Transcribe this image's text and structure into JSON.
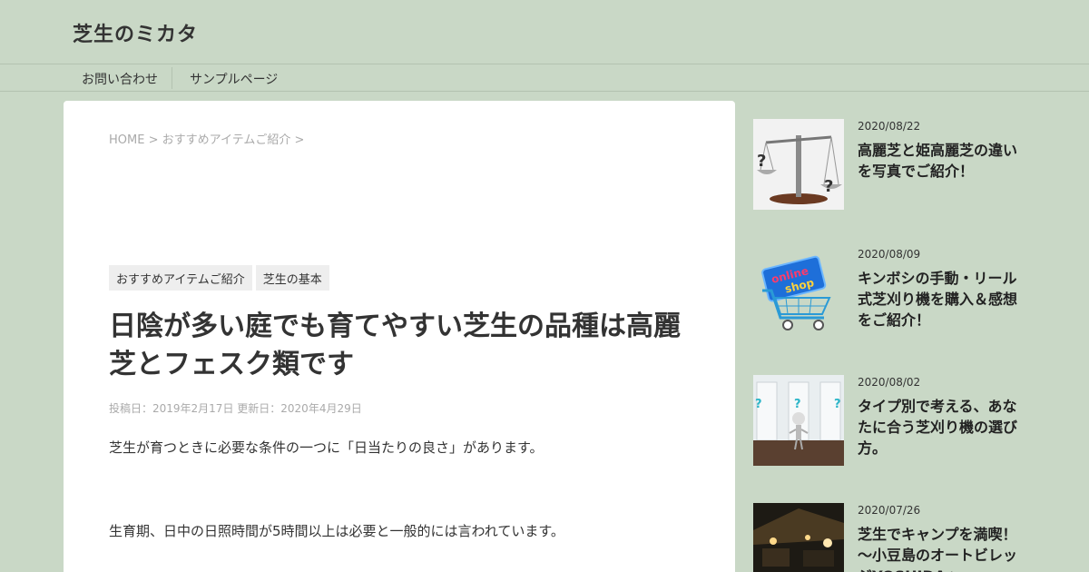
{
  "header": {
    "site_title": "芝生のミカタ"
  },
  "nav": {
    "items": [
      {
        "label": "お問い合わせ"
      },
      {
        "label": "サンプルページ"
      }
    ]
  },
  "article": {
    "breadcrumb": {
      "home": "HOME",
      "sep1": " > ",
      "category": "おすすめアイテムご紹介",
      "sep2": " >"
    },
    "categories": [
      {
        "label": "おすすめアイテムご紹介"
      },
      {
        "label": "芝生の基本"
      }
    ],
    "title": "日陰が多い庭でも育てやすい芝生の品種は高麗芝とフェスク類です",
    "posted": "投稿日：2019年2月17日",
    "updated": "更新日：2020年4月29日",
    "paragraphs": [
      "芝生が育つときに必要な条件の一つに「日当たりの良さ」があります。",
      "生育期、日中の日照時間が5時間以上は必要と一般的には言われています。"
    ]
  },
  "sidebar": {
    "posts": [
      {
        "date": "2020/08/22",
        "title": "高麗芝と姫高麗芝の違いを写真でご紹介！"
      },
      {
        "date": "2020/08/09",
        "title": "キンボシの手動・リール式芝刈り機を購入＆感想をご紹介！"
      },
      {
        "date": "2020/08/02",
        "title": "タイプ別で考える、あなたに合う芝刈り機の選び方。"
      },
      {
        "date": "2020/07/26",
        "title": "芝生でキャンプを満喫！～小豆島のオートビレッジYOSHIDAへ"
      }
    ]
  },
  "thumb_labels": {
    "shop_text": "online shop"
  }
}
